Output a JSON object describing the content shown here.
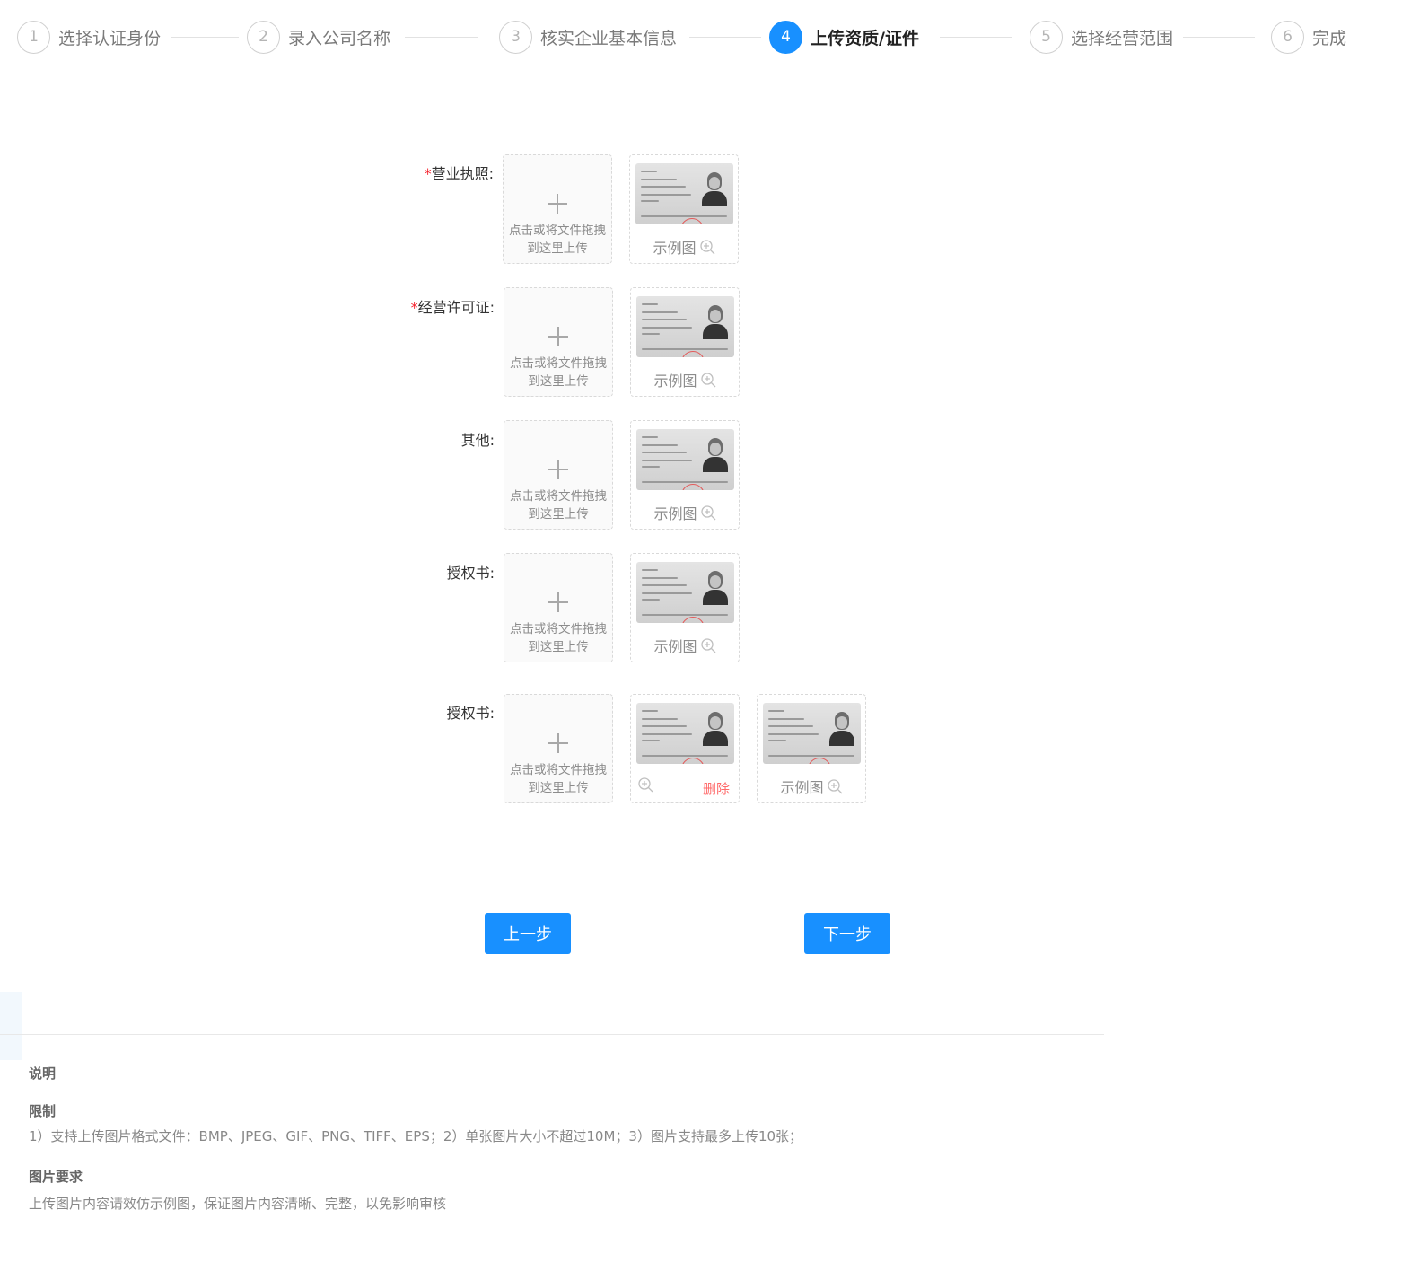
{
  "steps": [
    {
      "num": "1",
      "label": "选择认证身份"
    },
    {
      "num": "2",
      "label": "录入公司名称"
    },
    {
      "num": "3",
      "label": "核实企业基本信息"
    },
    {
      "num": "4",
      "label": "上传资质/证件"
    },
    {
      "num": "5",
      "label": "选择经营范围"
    },
    {
      "num": "6",
      "label": "完成"
    }
  ],
  "active_step": 4,
  "form": {
    "required_mark": "*",
    "upload_hint_line1": "点击或将文件拖拽",
    "upload_hint_line2": "到这里上传",
    "sample_caption": "示例图",
    "delete_label": "删除",
    "rows": [
      {
        "label": "营业执照:",
        "required": true
      },
      {
        "label": "经营许可证:",
        "required": true
      },
      {
        "label": "其他:",
        "required": false
      },
      {
        "label": "授权书:",
        "required": false
      },
      {
        "label": "授权书:",
        "required": false
      }
    ]
  },
  "buttons": {
    "prev": "上一步",
    "next": "下一步"
  },
  "description": {
    "title": "说明",
    "limit_title": "限制",
    "limit_text": "1）支持上传图片格式文件：BMP、JPEG、GIF、PNG、TIFF、EPS；2）单张图片大小不超过10M；3）图片支持最多上传10张；",
    "req_title": "图片要求",
    "req_text": "上传图片内容请效仿示例图，保证图片内容清晰、完整，以免影响审核"
  },
  "colors": {
    "primary": "#1890ff",
    "required": "#f5222d",
    "delete": "#ff6b6b"
  }
}
